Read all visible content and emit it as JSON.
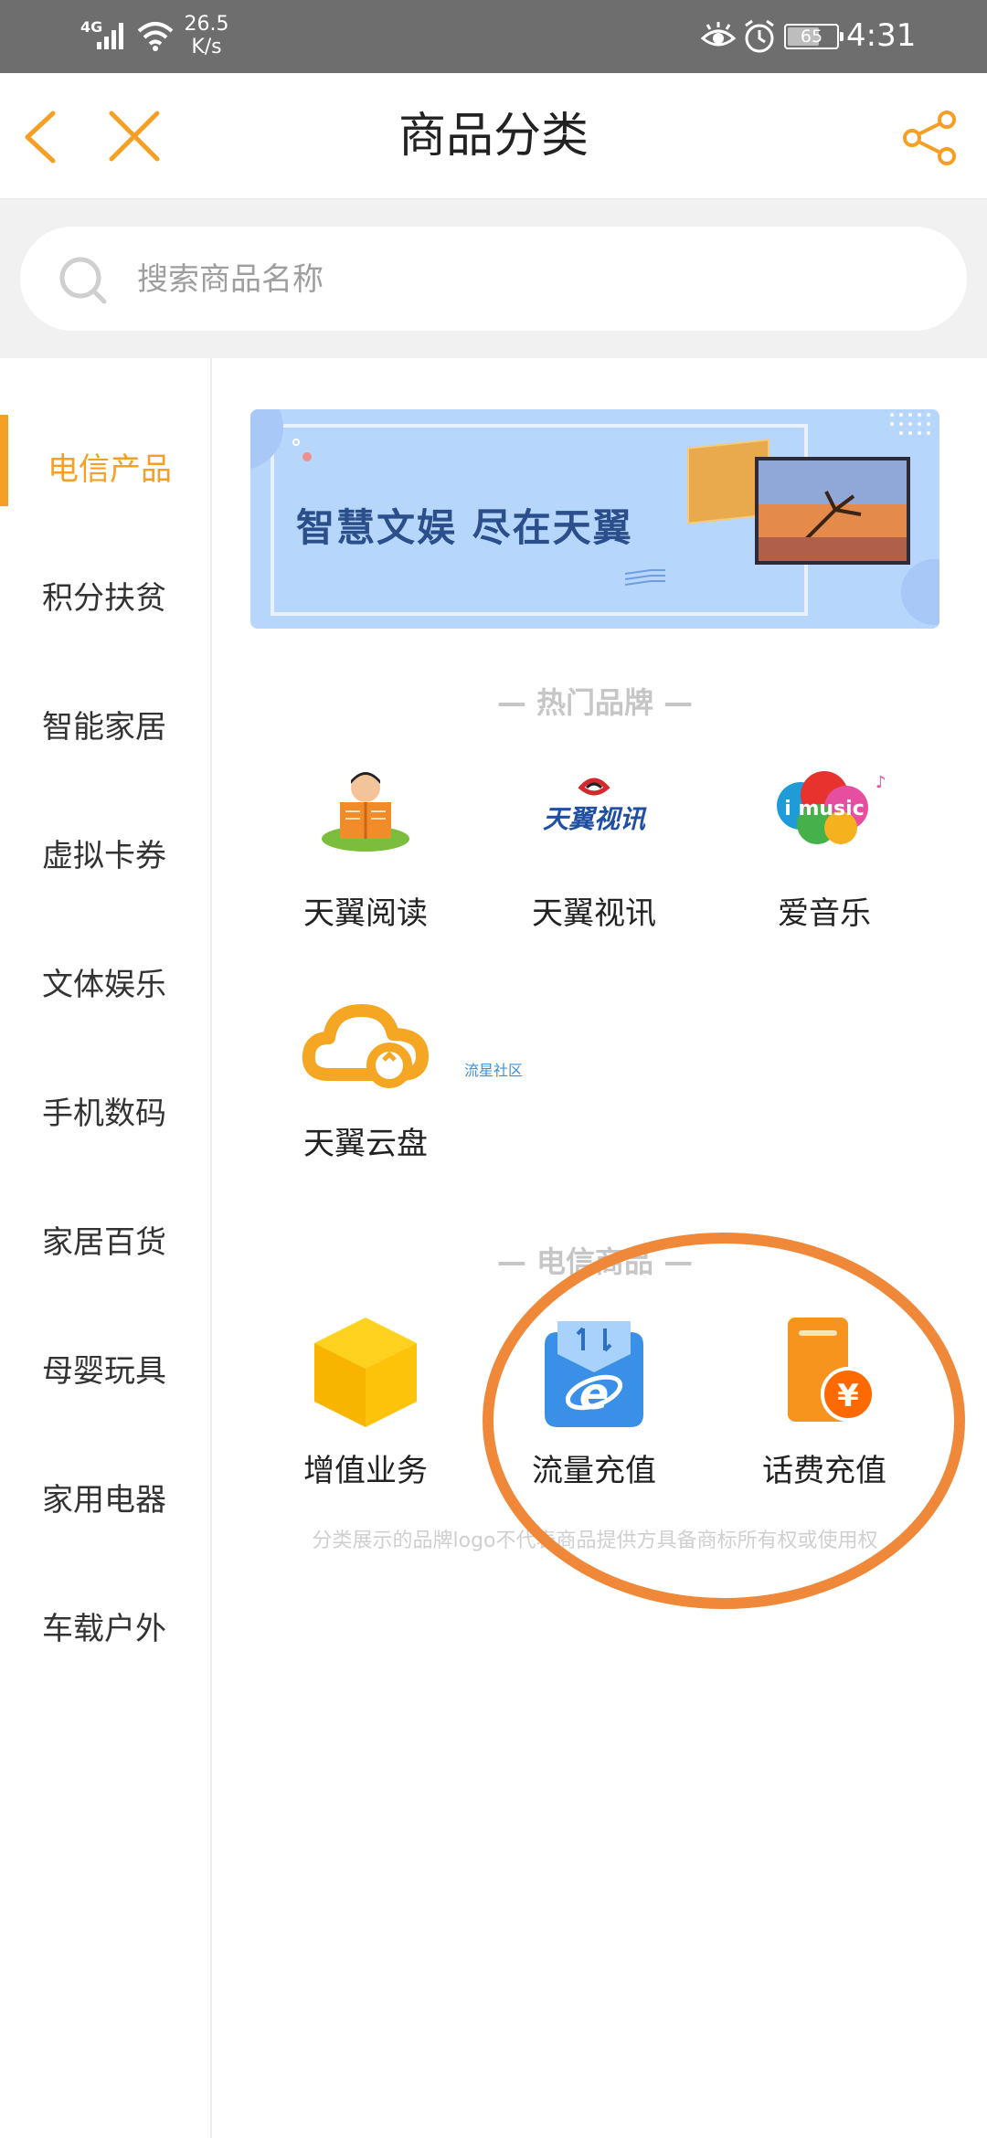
{
  "status_bar": {
    "network": "4G",
    "speed_value": "26.5",
    "speed_unit": "K/s",
    "battery": "65",
    "battery_level": 0.65,
    "time": "4:31"
  },
  "header": {
    "title": "商品分类"
  },
  "search": {
    "placeholder": "搜索商品名称"
  },
  "sidebar": {
    "items": [
      {
        "label": "电信产品",
        "active": true
      },
      {
        "label": "积分扶贫",
        "active": false
      },
      {
        "label": "智能家居",
        "active": false
      },
      {
        "label": "虚拟卡券",
        "active": false
      },
      {
        "label": "文体娱乐",
        "active": false
      },
      {
        "label": "手机数码",
        "active": false
      },
      {
        "label": "家居百货",
        "active": false
      },
      {
        "label": "母婴玩具",
        "active": false
      },
      {
        "label": "家用电器",
        "active": false
      },
      {
        "label": "车载户外",
        "active": false
      }
    ]
  },
  "banner": {
    "text": "智慧文娱 尽在天翼"
  },
  "hot_brands": {
    "title": "— 热门品牌 —",
    "items": [
      {
        "label": "天翼阅读",
        "icon": "reading-icon"
      },
      {
        "label": "天翼视讯",
        "icon": "video-logo-icon",
        "logo_text": "天翼视讯"
      },
      {
        "label": "爱音乐",
        "icon": "music-logo-icon",
        "logo_text": "i music"
      },
      {
        "label": "天翼云盘",
        "icon": "cloud-icon"
      }
    ],
    "extra_link": "流星社区"
  },
  "telecom_products": {
    "title": "— 电信商品 —",
    "items": [
      {
        "label": "增值业务",
        "icon": "cube-icon"
      },
      {
        "label": "流量充值",
        "icon": "data-topup-icon"
      },
      {
        "label": "话费充值",
        "icon": "phone-topup-icon"
      }
    ]
  },
  "footnote": "分类展示的品牌logo不代表商品提供方具备商标所有权或使用权",
  "colors": {
    "accent": "#f5a024",
    "annotation": "#f0883a",
    "status_bar": "#6e6e6e"
  }
}
